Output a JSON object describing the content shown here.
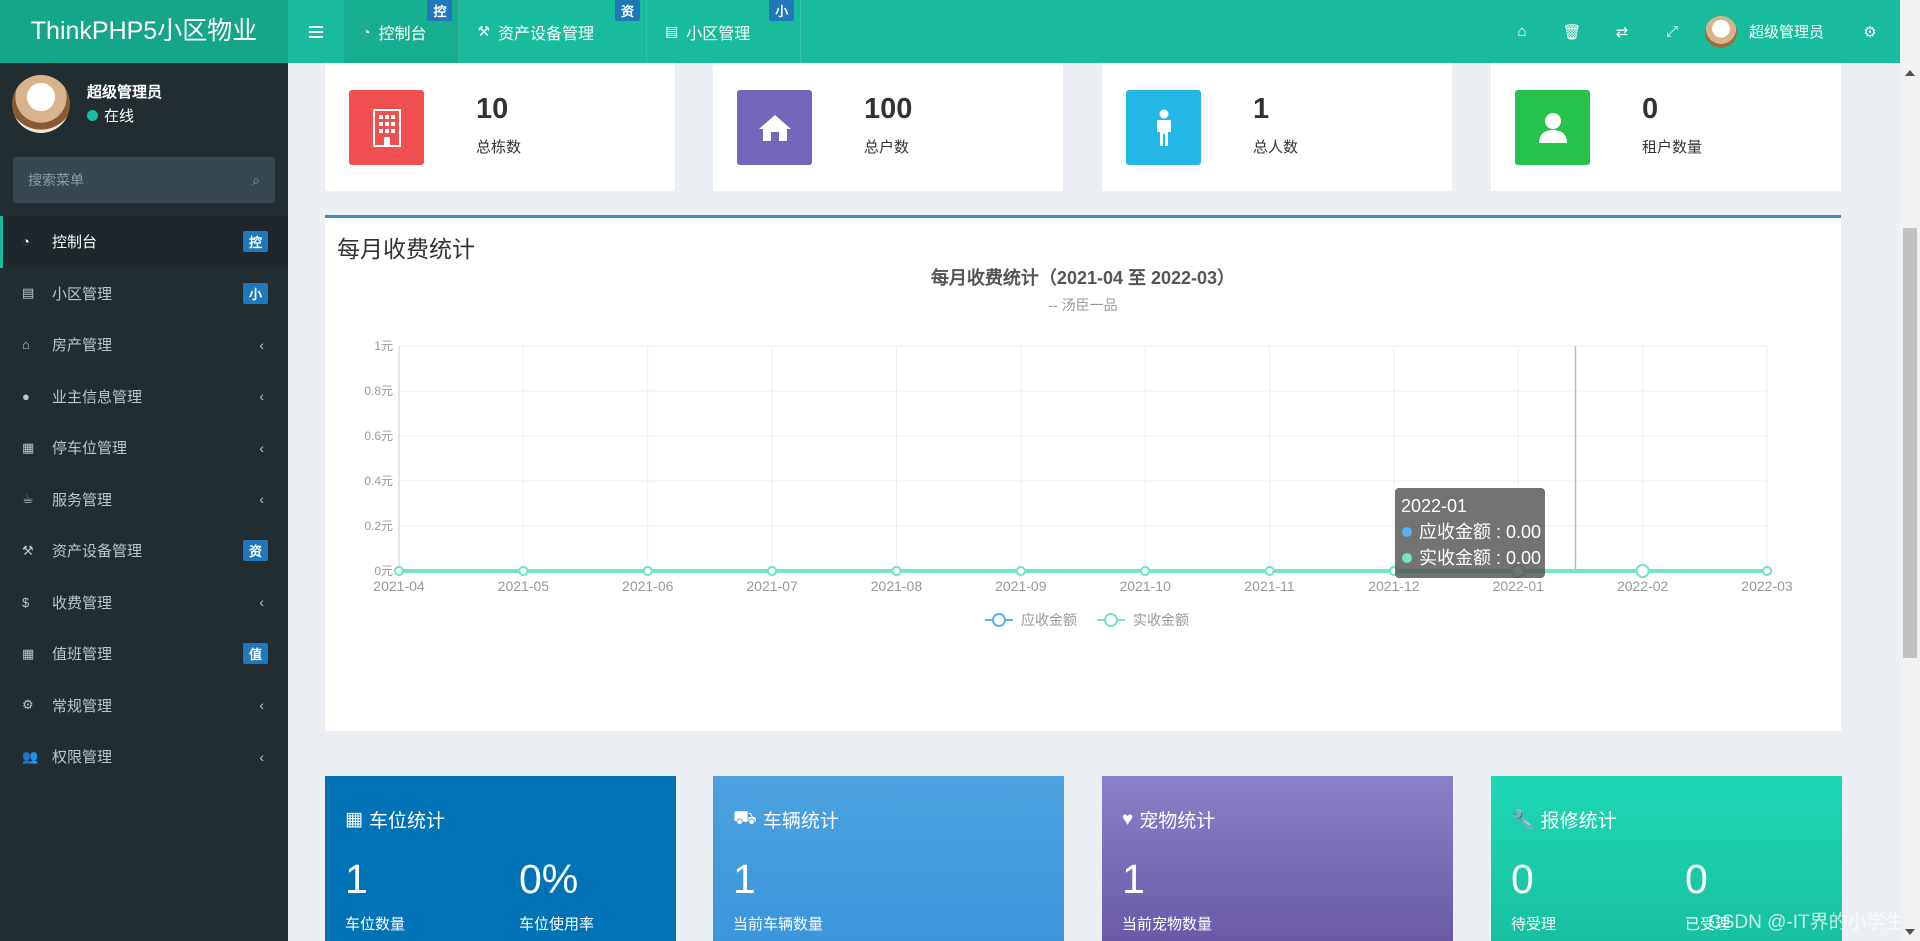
{
  "app": {
    "title": "ThinkPHP5小区物业"
  },
  "header": {
    "tabs": [
      {
        "label": "控制台",
        "badge": "控"
      },
      {
        "label": "资产设备管理",
        "badge": "资"
      },
      {
        "label": "小区管理",
        "badge": "小"
      }
    ],
    "user_name": "超级管理员"
  },
  "sidebar": {
    "user_name": "超级管理员",
    "status": "在线",
    "search_placeholder": "搜索菜单",
    "items": [
      {
        "label": "控制台",
        "badge": "控",
        "icon": "dashboard-icon"
      },
      {
        "label": "小区管理",
        "badge": "小",
        "icon": "list-icon"
      },
      {
        "label": "房产管理",
        "icon": "home-icon"
      },
      {
        "label": "业主信息管理",
        "icon": "user-icon"
      },
      {
        "label": "停车位管理",
        "icon": "film-icon"
      },
      {
        "label": "服务管理",
        "icon": "coffee-icon"
      },
      {
        "label": "资产设备管理",
        "badge": "资",
        "icon": "gavel-icon"
      },
      {
        "label": "收费管理",
        "icon": "dollar-icon"
      },
      {
        "label": "值班管理",
        "badge": "值",
        "icon": "calendar-icon"
      },
      {
        "label": "常规管理",
        "icon": "cogs-icon"
      },
      {
        "label": "权限管理",
        "icon": "users-icon"
      }
    ]
  },
  "stats": [
    {
      "value": "10",
      "label": "总栋数",
      "color": "#f05050",
      "icon": "building-icon"
    },
    {
      "value": "100",
      "label": "总户数",
      "color": "#7266ba",
      "icon": "home-icon"
    },
    {
      "value": "1",
      "label": "总人数",
      "color": "#23b7e5",
      "icon": "male-icon"
    },
    {
      "value": "0",
      "label": "租户数量",
      "color": "#27c24c",
      "icon": "user-icon"
    }
  ],
  "chart_box": {
    "title": "每月收费统计"
  },
  "chart_data": {
    "type": "line",
    "title": "每月收费统计（2021-04 至 2022-03）",
    "subtitle": "-- 汤臣一品",
    "categories": [
      "2021-04",
      "2021-05",
      "2021-06",
      "2021-07",
      "2021-08",
      "2021-09",
      "2021-10",
      "2021-11",
      "2021-12",
      "2022-01",
      "2022-02",
      "2022-03"
    ],
    "y_ticks": [
      "0元",
      "0.2元",
      "0.4元",
      "0.6元",
      "0.8元",
      "1元"
    ],
    "ylim": [
      0,
      1
    ],
    "series": [
      {
        "name": "应收金额",
        "values": [
          0,
          0,
          0,
          0,
          0,
          0,
          0,
          0,
          0,
          0,
          0,
          0
        ],
        "color": "#5ab1ef"
      },
      {
        "name": "实收金额",
        "values": [
          0,
          0,
          0,
          0,
          0,
          0,
          0,
          0,
          0,
          0,
          0,
          0
        ],
        "color": "#75e4c7"
      }
    ],
    "legend": "bottom-center",
    "grid": true,
    "tooltip": {
      "title": "2022-01",
      "lines": [
        "应收金额 : 0.00",
        "实收金额 : 0.00"
      ]
    }
  },
  "color_boxes": [
    {
      "title": "车位统计",
      "icon": "film-icon",
      "color": "#0073b7",
      "items": [
        {
          "value": "1",
          "label": "车位数量"
        },
        {
          "value": "0%",
          "label": "车位使用率"
        }
      ]
    },
    {
      "title": "车辆统计",
      "icon": "truck-icon",
      "color": "#4ca2e0",
      "items": [
        {
          "value": "1",
          "label": "当前车辆数量"
        }
      ]
    },
    {
      "title": "宠物统计",
      "icon": "heart-icon",
      "color": "#7d6fc1",
      "items": [
        {
          "value": "1",
          "label": "当前宠物数量"
        }
      ]
    },
    {
      "title": "报修统计",
      "icon": "wrench-icon",
      "color": "#1ed1b0",
      "items": [
        {
          "value": "0",
          "label": "待受理"
        },
        {
          "value": "0",
          "label": "已受理"
        }
      ]
    }
  ],
  "watermark": "CSDN @-IT界的小学生"
}
